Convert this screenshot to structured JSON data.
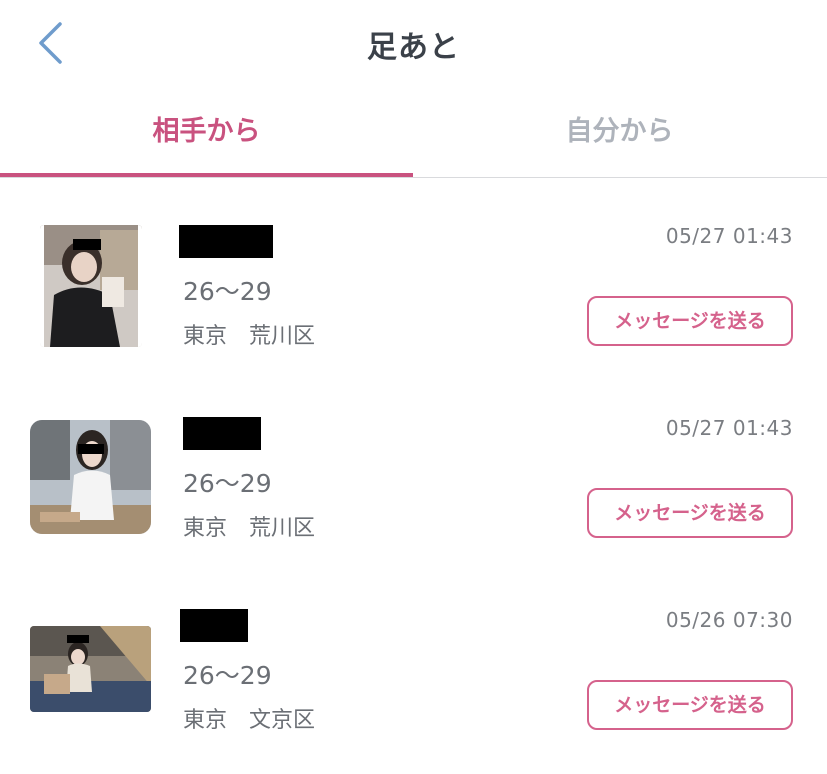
{
  "header": {
    "title": "足あと",
    "back_icon": "chevron-left-icon",
    "accent": "#6f9ccc"
  },
  "tabs": [
    {
      "label": "相手から",
      "active": true
    },
    {
      "label": "自分から",
      "active": false
    }
  ],
  "colors": {
    "accent": "#c9527f",
    "inactive": "#aeb3bb",
    "text": "#6b6f75"
  },
  "visitors": [
    {
      "age": "26〜29",
      "location": "東京　荒川区",
      "time": "05/27 01:43",
      "button": "メッセージを送る"
    },
    {
      "age": "26〜29",
      "location": "東京　荒川区",
      "time": "05/27 01:43",
      "button": "メッセージを送る"
    },
    {
      "age": "26〜29",
      "location": "東京　文京区",
      "time": "05/26 07:30",
      "button": "メッセージを送る"
    }
  ]
}
